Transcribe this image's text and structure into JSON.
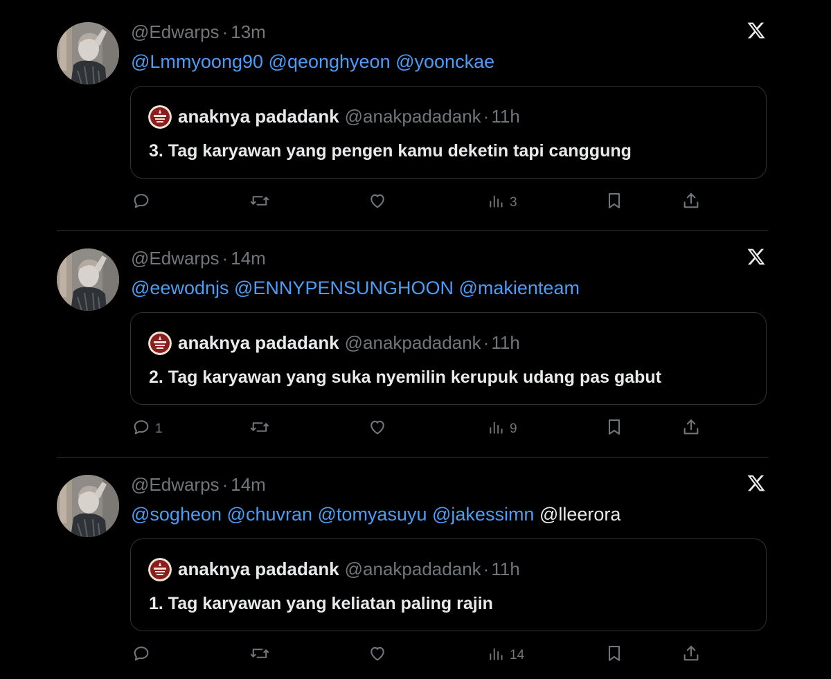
{
  "tweets": [
    {
      "handle": "@Edwarps",
      "time": "13m",
      "mentions": [
        {
          "text": "@Lmmyoong90",
          "linked": true
        },
        {
          "text": "@qeonghyeon",
          "linked": true
        },
        {
          "text": "@yoonckae",
          "linked": true
        }
      ],
      "quote": {
        "name": "anaknya padadank",
        "handle": "@anakpadadank",
        "time": "11h",
        "text": "3. Tag karyawan yang pengen kamu deketin tapi canggung"
      },
      "counts": {
        "reply": "",
        "retweet": "",
        "like": "",
        "views": "3"
      }
    },
    {
      "handle": "@Edwarps",
      "time": "14m",
      "mentions": [
        {
          "text": "@eewodnjs",
          "linked": true
        },
        {
          "text": "@ENNYPENSUNGHOON",
          "linked": true
        },
        {
          "text": "@makienteam",
          "linked": true
        }
      ],
      "quote": {
        "name": "anaknya padadank",
        "handle": "@anakpadadank",
        "time": "11h",
        "text": "2. Tag karyawan yang suka nyemilin kerupuk udang pas gabut"
      },
      "counts": {
        "reply": "1",
        "retweet": "",
        "like": "",
        "views": "9"
      }
    },
    {
      "handle": "@Edwarps",
      "time": "14m",
      "mentions": [
        {
          "text": "@sogheon",
          "linked": true
        },
        {
          "text": "@chuvran",
          "linked": true
        },
        {
          "text": "@tomyasuyu",
          "linked": true
        },
        {
          "text": "@jakessimn",
          "linked": true
        },
        {
          "text": "@lleerora",
          "linked": false
        }
      ],
      "quote": {
        "name": "anaknya padadank",
        "handle": "@anakpadadank",
        "time": "11h",
        "text": "1. Tag karyawan yang keliatan paling rajin"
      },
      "counts": {
        "reply": "",
        "retweet": "",
        "like": "",
        "views": "14"
      }
    }
  ],
  "separator": "·",
  "icons": {
    "close": "x-logo-icon",
    "reply": "reply-icon",
    "retweet": "retweet-icon",
    "like": "heart-icon",
    "views": "views-icon",
    "bookmark": "bookmark-icon",
    "share": "share-icon"
  },
  "colors": {
    "background": "#000000",
    "text": "#e7e9ea",
    "muted": "#71767b",
    "mention": "#4d9cf5",
    "border": "#2f3336"
  }
}
